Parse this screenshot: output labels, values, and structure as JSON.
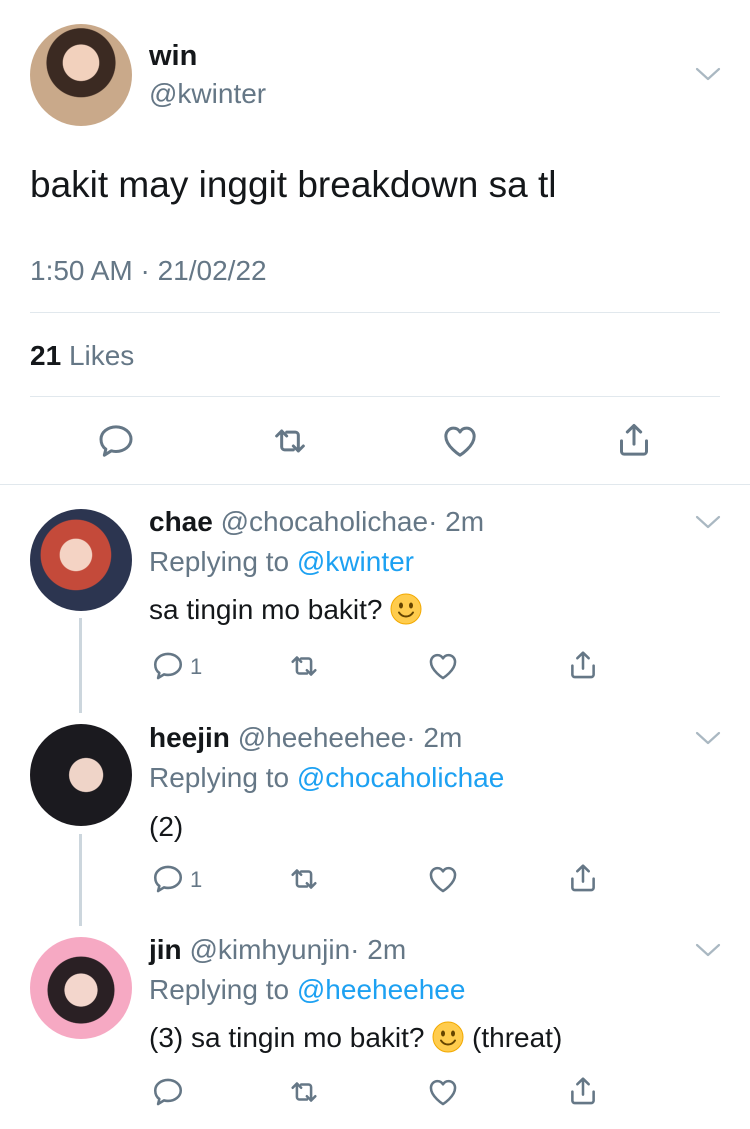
{
  "main_tweet": {
    "name": "win",
    "handle": "@kwinter",
    "text": "bakit may inggit breakdown sa tl",
    "timestamp": "1:50 AM · 21/02/22",
    "likes_count": "21",
    "likes_label": "Likes"
  },
  "replies": [
    {
      "name": "chae",
      "handle": "@chocaholichae",
      "time": "· 2m",
      "replying_prefix": "Replying to",
      "replying_to": "@kwinter",
      "text": "sa tingin mo bakit?",
      "reply_count": "1"
    },
    {
      "name": "heejin",
      "handle": "@heeheehee",
      "time": "· 2m",
      "replying_prefix": "Replying to",
      "replying_to": "@chocaholichae",
      "text": "(2)",
      "reply_count": "1"
    },
    {
      "name": "jin",
      "handle": "@kimhyunjin",
      "time": "· 2m",
      "replying_prefix": "Replying to",
      "replying_to": "@heeheehee",
      "text_before_emoji": "(3) sa tingin mo bakit?",
      "text_after_emoji": "(threat)"
    }
  ],
  "icons": {
    "reply": "reply-icon",
    "retweet": "retweet-icon",
    "like": "heart-icon",
    "share": "share-icon",
    "more": "chevron-down-icon",
    "emoji": "slightly-smiling-face-emoji"
  },
  "colors": {
    "text": "#14171a",
    "muted": "#657786",
    "link": "#1da1f2",
    "divider": "#e1e8ed",
    "thread_line": "#ccd6dd"
  }
}
